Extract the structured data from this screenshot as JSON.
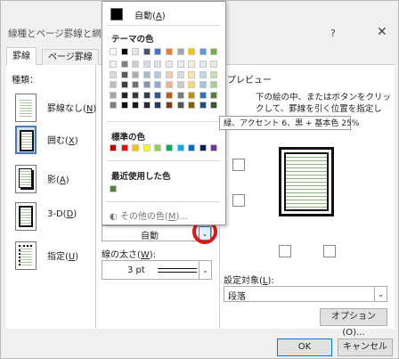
{
  "dialog": {
    "title": "線種とページ罫線と網かけ",
    "help": "?",
    "close": "✕",
    "tabs": [
      {
        "label": "罫線"
      },
      {
        "label": "ページ罫線"
      }
    ]
  },
  "left": {
    "heading": "種類：",
    "items": [
      {
        "label": "罫線なし",
        "key": "N"
      },
      {
        "label": "囲む",
        "key": "X"
      },
      {
        "label": "影",
        "key": "A"
      },
      {
        "label": "3-D",
        "key": "D"
      },
      {
        "label": "指定",
        "key": "U"
      }
    ]
  },
  "color_dropdown": {
    "auto_label": "自動",
    "auto_key": "A",
    "theme_label": "テーマの色",
    "standard_label": "標準の色",
    "recent_label": "最近使用した色",
    "more_label": "その他の色",
    "more_key": "M",
    "more_suffix": "...",
    "theme_top": [
      "#ffffff",
      "#000000",
      "#e7e6e6",
      "#44546a",
      "#4472c4",
      "#ed7d31",
      "#a5a5a5",
      "#ffc000",
      "#5b9bd5",
      "#70ad47"
    ],
    "theme_shades": [
      [
        "#f2f2f2",
        "#7f7f7f",
        "#d0cece",
        "#d6dce4",
        "#d9e2f3",
        "#fbe5d5",
        "#ededed",
        "#fff2cc",
        "#deebf6",
        "#e2efd9"
      ],
      [
        "#d8d8d8",
        "#595959",
        "#aeabab",
        "#adb9ca",
        "#b4c6e7",
        "#f7cbac",
        "#dbdbdb",
        "#fee599",
        "#bdd7ee",
        "#c5e0b3"
      ],
      [
        "#bfbfbf",
        "#3f3f3f",
        "#757070",
        "#8496b0",
        "#8eaadb",
        "#f4b183",
        "#c9c9c9",
        "#ffd965",
        "#9cc3e5",
        "#a8d08d"
      ],
      [
        "#a5a5a5",
        "#262626",
        "#3a3838",
        "#323e4f",
        "#2f5496",
        "#c55a11",
        "#7b7b7b",
        "#bf9000",
        "#2e75b5",
        "#538135"
      ],
      [
        "#7f7f7f",
        "#0c0c0c",
        "#171616",
        "#222a35",
        "#1f3864",
        "#833c0b",
        "#525252",
        "#7f6000",
        "#1e4e79",
        "#375623"
      ]
    ],
    "standard_colors": [
      "#c00000",
      "#ff0000",
      "#ffc000",
      "#ffff00",
      "#92d050",
      "#00b050",
      "#00b0f0",
      "#0070c0",
      "#002060",
      "#7030a0"
    ],
    "recent_colors": [
      "#538135"
    ],
    "highlighted_swatch": "#538135"
  },
  "tooltip": "緑、アクセント 6、黒 + 基本色 25%",
  "line_color_value": "自動",
  "line_width": {
    "label": "線の太さ",
    "key": "W",
    "value": "3 pt"
  },
  "preview": {
    "heading": "プレビュー",
    "instruction_1": "下の絵の中、またはボタンをクリッ",
    "instruction_2": "クして、罫線を引く位置を指定し"
  },
  "apply_to": {
    "label": "設定対象",
    "key": "L",
    "value": "段落"
  },
  "buttons": {
    "options": "オプション(O)...",
    "ok": "OK",
    "cancel": "キャンセル"
  }
}
